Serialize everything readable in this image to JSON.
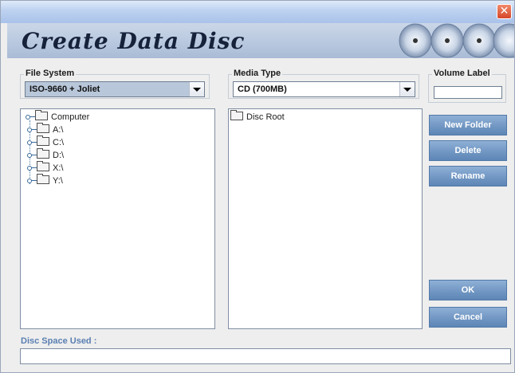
{
  "window": {
    "close_glyph": "✕",
    "banner_title": "Create Data Disc"
  },
  "file_system": {
    "label": "File System",
    "selected": "ISO-9660 + Joliet"
  },
  "media_type": {
    "label": "Media Type",
    "selected": "CD (700MB)"
  },
  "volume_label": {
    "label": "Volume Label",
    "value": ""
  },
  "source_tree": {
    "root": "Computer",
    "drives": [
      "A:\\",
      "C:\\",
      "D:\\",
      "X:\\",
      "Y:\\"
    ]
  },
  "disc_tree": {
    "root": "Disc Root"
  },
  "buttons": {
    "new_folder": "New Folder",
    "delete": "Delete",
    "rename": "Rename",
    "ok": "OK",
    "cancel": "Cancel"
  },
  "status": {
    "label": "Disc Space Used :",
    "value": ""
  },
  "colors": {
    "accent": "#5e86b6",
    "status_label": "#5a7fb2"
  }
}
